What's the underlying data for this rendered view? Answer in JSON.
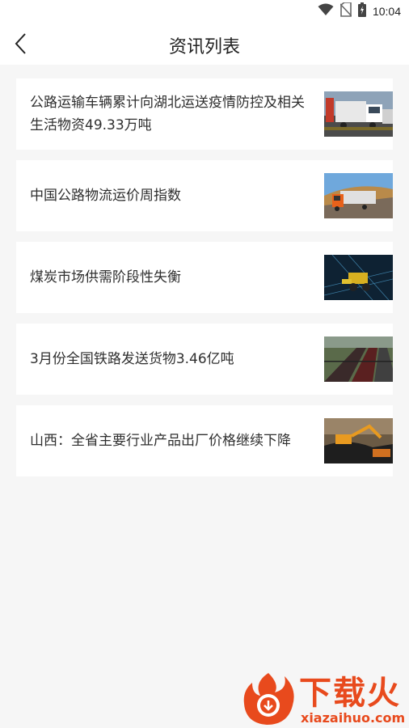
{
  "status_bar": {
    "time": "10:04",
    "icons": [
      "wifi-icon",
      "no-sim-icon",
      "battery-icon"
    ]
  },
  "header": {
    "title": "资讯列表",
    "back_icon": "chevron-left-icon"
  },
  "news": [
    {
      "title": "公路运输车辆累计向湖北运送疫情防控及相关生活物资49.33万吨",
      "thumbnail": "trucks-convoy"
    },
    {
      "title": "中国公路物流运价周指数",
      "thumbnail": "orange-truck-highway"
    },
    {
      "title": "煤炭市场供需阶段性失衡",
      "thumbnail": "loader-digital"
    },
    {
      "title": "3月份全国铁路发送货物3.46亿吨",
      "thumbnail": "freight-train"
    },
    {
      "title": "山西：全省主要行业产品出厂价格继续下降",
      "thumbnail": "excavator-coal"
    }
  ],
  "watermark": {
    "title": "下载火",
    "url": "xiazaihuo.com"
  },
  "colors": {
    "background": "#f6f6f6",
    "card": "#ffffff",
    "watermark": "#e84a1d"
  }
}
